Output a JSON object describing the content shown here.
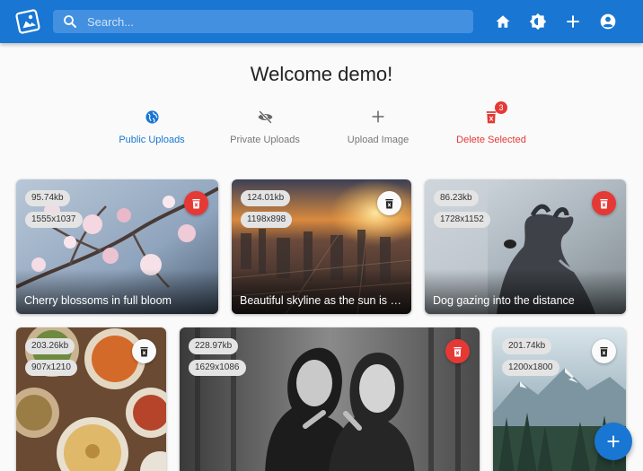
{
  "app": {
    "logo_icon": "image-gallery-logo-icon"
  },
  "search": {
    "placeholder": "Search..."
  },
  "toolbar": {
    "icons": [
      "home-icon",
      "theme-brightness-icon",
      "add-icon",
      "account-circle-icon"
    ]
  },
  "welcome": "Welcome demo!",
  "tabs": [
    {
      "label": "Public Uploads",
      "icon": "globe-icon"
    },
    {
      "label": "Private Uploads",
      "icon": "eye-off-icon"
    },
    {
      "label": "Upload Image",
      "icon": "plus-icon"
    },
    {
      "label": "Delete Selected",
      "icon": "delete-icon",
      "badge": "3"
    }
  ],
  "images": [
    {
      "size": "95.74kb",
      "dims": "1555x1037",
      "caption": "Cherry blossoms in full bloom",
      "selected": true
    },
    {
      "size": "124.01kb",
      "dims": "1198x898",
      "caption": "Beautiful skyline as the sun is ri...",
      "selected": false
    },
    {
      "size": "86.23kb",
      "dims": "1728x1152",
      "caption": "Dog gazing into the distance",
      "selected": true
    },
    {
      "size": "203.26kb",
      "dims": "907x1210",
      "caption": "",
      "selected": false
    },
    {
      "size": "228.97kb",
      "dims": "1629x1086",
      "caption": "",
      "selected": true
    },
    {
      "size": "201.74kb",
      "dims": "1200x1800",
      "caption": "",
      "selected": false
    }
  ],
  "colors": {
    "primary": "#1976d2",
    "danger": "#e53935",
    "background": "#fafafa"
  },
  "fab": {
    "icon": "plus-icon"
  }
}
